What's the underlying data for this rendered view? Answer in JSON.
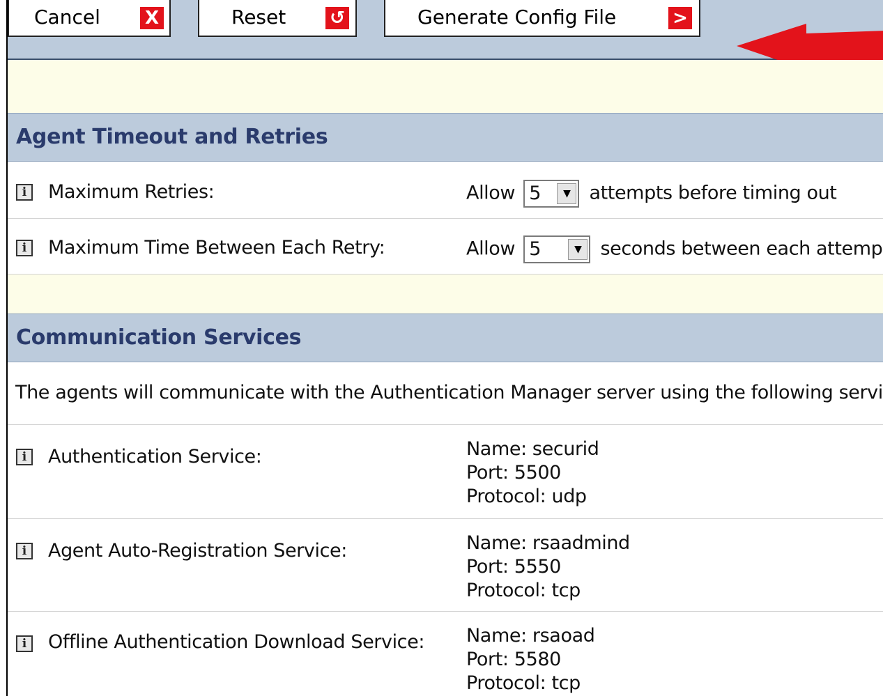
{
  "toolbar": {
    "cancel_label": "Cancel",
    "cancel_icon": "X",
    "reset_label": "Reset",
    "reset_icon": "↺",
    "generate_label": "Generate Config File",
    "generate_icon": ">",
    "icon_color": "#e3131b",
    "callout_arrow_color": "#e3131b"
  },
  "agent_timeout": {
    "title": "Agent Timeout and Retries",
    "rows": [
      {
        "label": "Maximum Retries:",
        "prefix": "Allow",
        "value": "5",
        "suffix": "attempts before timing out"
      },
      {
        "label": "Maximum Time Between Each Retry:",
        "prefix": "Allow",
        "value": "5",
        "suffix": "seconds between each attempt"
      }
    ]
  },
  "communication": {
    "title": "Communication Services",
    "description": "The agents will communicate with the Authentication Manager server using the following service r",
    "services": [
      {
        "label": "Authentication Service:",
        "name": "Name: securid",
        "port": "Port: 5500",
        "protocol": "Protocol: udp"
      },
      {
        "label": "Agent Auto-Registration Service:",
        "name": "Name: rsaadmind",
        "port": "Port: 5550",
        "protocol": "Protocol: tcp"
      },
      {
        "label": "Offline Authentication Download Service:",
        "name": "Name: rsaoad",
        "port": "Port: 5580",
        "protocol": "Protocol: tcp"
      }
    ]
  },
  "info_icon_glyph": "i"
}
